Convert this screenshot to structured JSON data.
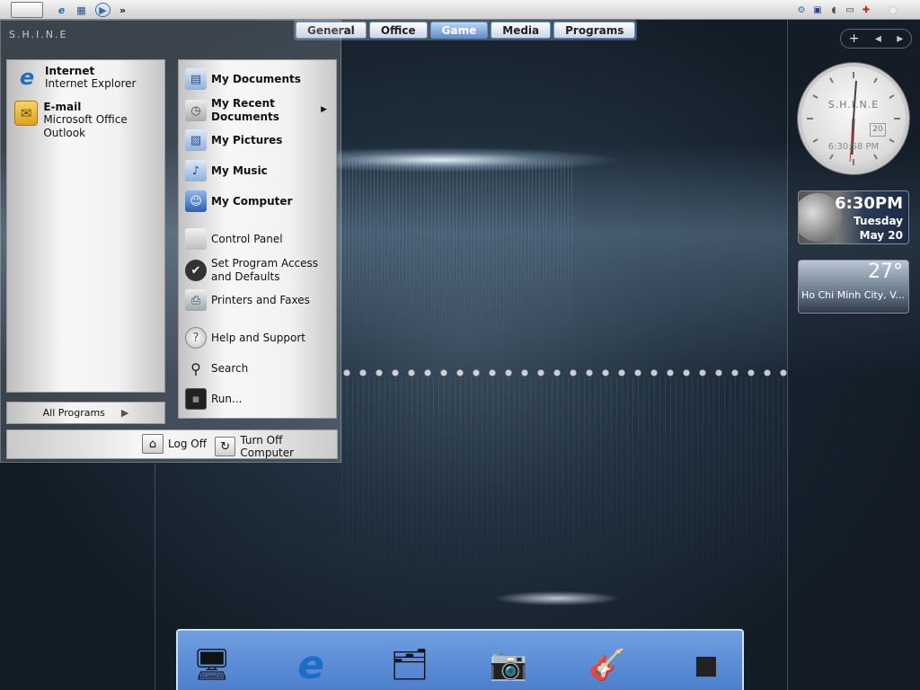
{
  "topbar": {
    "start_glyph": "",
    "quicklaunch": [
      {
        "name": "ie-icon",
        "glyph": "e"
      },
      {
        "name": "media-icon",
        "glyph": "▦"
      },
      {
        "name": "player-icon",
        "glyph": "▶"
      },
      {
        "name": "overflow-icon",
        "glyph": "»"
      }
    ],
    "tray": [
      {
        "name": "network-icon",
        "glyph": "⚙"
      },
      {
        "name": "monitor-icon",
        "glyph": "▣"
      },
      {
        "name": "volume-icon",
        "glyph": "◖"
      },
      {
        "name": "battery-icon",
        "glyph": "▭"
      },
      {
        "name": "security-icon",
        "glyph": "✚"
      },
      {
        "name": "dot-icon",
        "glyph": "●"
      }
    ]
  },
  "tabs": [
    "General",
    "Office",
    "Game",
    "Media",
    "Programs"
  ],
  "active_tab": "Game",
  "start_menu": {
    "brand": "S.H.I.N.E",
    "pinned": [
      {
        "title": "Internet",
        "subtitle": "Internet Explorer",
        "icon": "ie-icon",
        "glyph": "e"
      },
      {
        "title": "E-mail",
        "subtitle": "Microsoft Office Outlook",
        "icon": "outlook-icon",
        "glyph": "✉"
      }
    ],
    "all_programs": "All Programs",
    "places": [
      {
        "label": "My Documents",
        "icon": "documents-icon",
        "glyph": "▤",
        "bold": true
      },
      {
        "label": "My Recent Documents",
        "line1": "My Recent",
        "line2": "Documents",
        "icon": "recent-icon",
        "glyph": "◷",
        "bold": true,
        "submenu": true
      },
      {
        "label": "My Pictures",
        "icon": "pictures-icon",
        "glyph": "▨",
        "bold": true
      },
      {
        "label": "My Music",
        "icon": "music-icon",
        "glyph": "♪",
        "bold": true
      },
      {
        "label": "My Computer",
        "icon": "computer-icon",
        "glyph": "☺",
        "bold": true
      },
      {
        "label": "Control Panel",
        "icon": "control-panel-icon",
        "glyph": "",
        "bold": false
      },
      {
        "label": "Set Program Access and Defaults",
        "line1": "Set Program Access",
        "line2": "and Defaults",
        "icon": "checkmark-icon",
        "glyph": "✔",
        "bold": false
      },
      {
        "label": "Printers and Faxes",
        "icon": "printer-icon",
        "glyph": "⎙",
        "bold": false
      },
      {
        "label": "Help and Support",
        "icon": "help-icon",
        "glyph": "?",
        "bold": false
      },
      {
        "label": "Search",
        "icon": "search-icon",
        "glyph": "⚲",
        "bold": false
      },
      {
        "label": "Run...",
        "icon": "run-icon",
        "glyph": "▪",
        "bold": false
      }
    ],
    "log_off": "Log Off",
    "turn_off": "Turn Off Computer"
  },
  "sidebar": {
    "controls": [
      "+",
      "◂",
      "▸"
    ],
    "clock": {
      "label": "S.H.I.N.E",
      "date_box": "20",
      "digital": "6:30:58 PM"
    },
    "calendar": {
      "time": "6:30PM",
      "day": "Tuesday",
      "date": "May 20"
    },
    "weather": {
      "temp": "27°",
      "city": "Ho Chi Minh City, V..."
    }
  },
  "dock": [
    {
      "name": "desktop-dock-icon",
      "glyph": "🖥"
    },
    {
      "name": "ie-dock-icon",
      "glyph": "e"
    },
    {
      "name": "documents-dock-icon",
      "glyph": "🗂"
    },
    {
      "name": "camera-dock-icon",
      "glyph": "📷"
    },
    {
      "name": "music-dock-icon",
      "glyph": "🎸"
    },
    {
      "name": "dock-app-icon",
      "glyph": "◼"
    }
  ],
  "colors": {
    "accent": "#5f8fd0",
    "dock": "#4d7fcc",
    "desktop": "#223140"
  }
}
